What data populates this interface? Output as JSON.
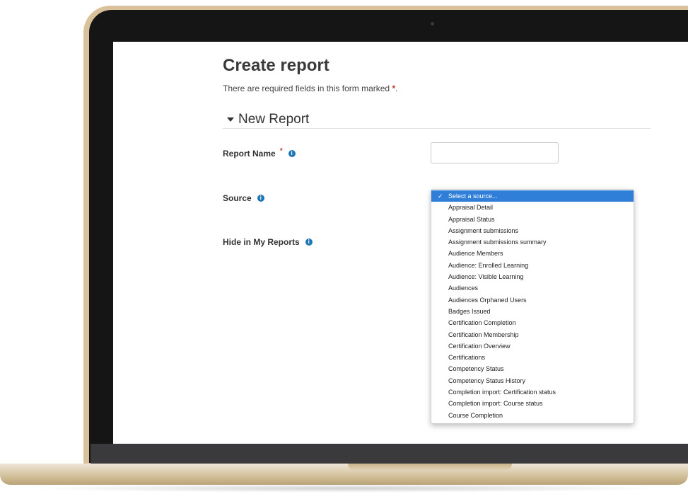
{
  "page": {
    "title": "Create report",
    "required_note": "There are required fields in this form marked",
    "required_marker": "*"
  },
  "section": {
    "title": "New Report"
  },
  "fields": {
    "report_name_label": "Report Name",
    "report_name_value": "",
    "source_label": "Source",
    "hide_label": "Hide in My Reports"
  },
  "source_dropdown": {
    "selected": "Select a source...",
    "options": [
      "Select a source...",
      "Appraisal Detail",
      "Appraisal Status",
      "Assignment submissions",
      "Assignment submissions summary",
      "Audience Members",
      "Audience: Enrolled Learning",
      "Audience: Visible Learning",
      "Audiences",
      "Audiences Orphaned Users",
      "Badges Issued",
      "Certification Completion",
      "Certification Membership",
      "Certification Overview",
      "Certifications",
      "Competency Status",
      "Competency Status History",
      "Completion import: Certification status",
      "Completion import: Course status",
      "Course Completion"
    ]
  },
  "icons": {
    "info": "info-icon",
    "caret": "caret-down-icon",
    "check": "check-icon"
  },
  "colors": {
    "accent": "#2f7fd8",
    "required": "#c0392b",
    "info": "#1f77b4"
  }
}
